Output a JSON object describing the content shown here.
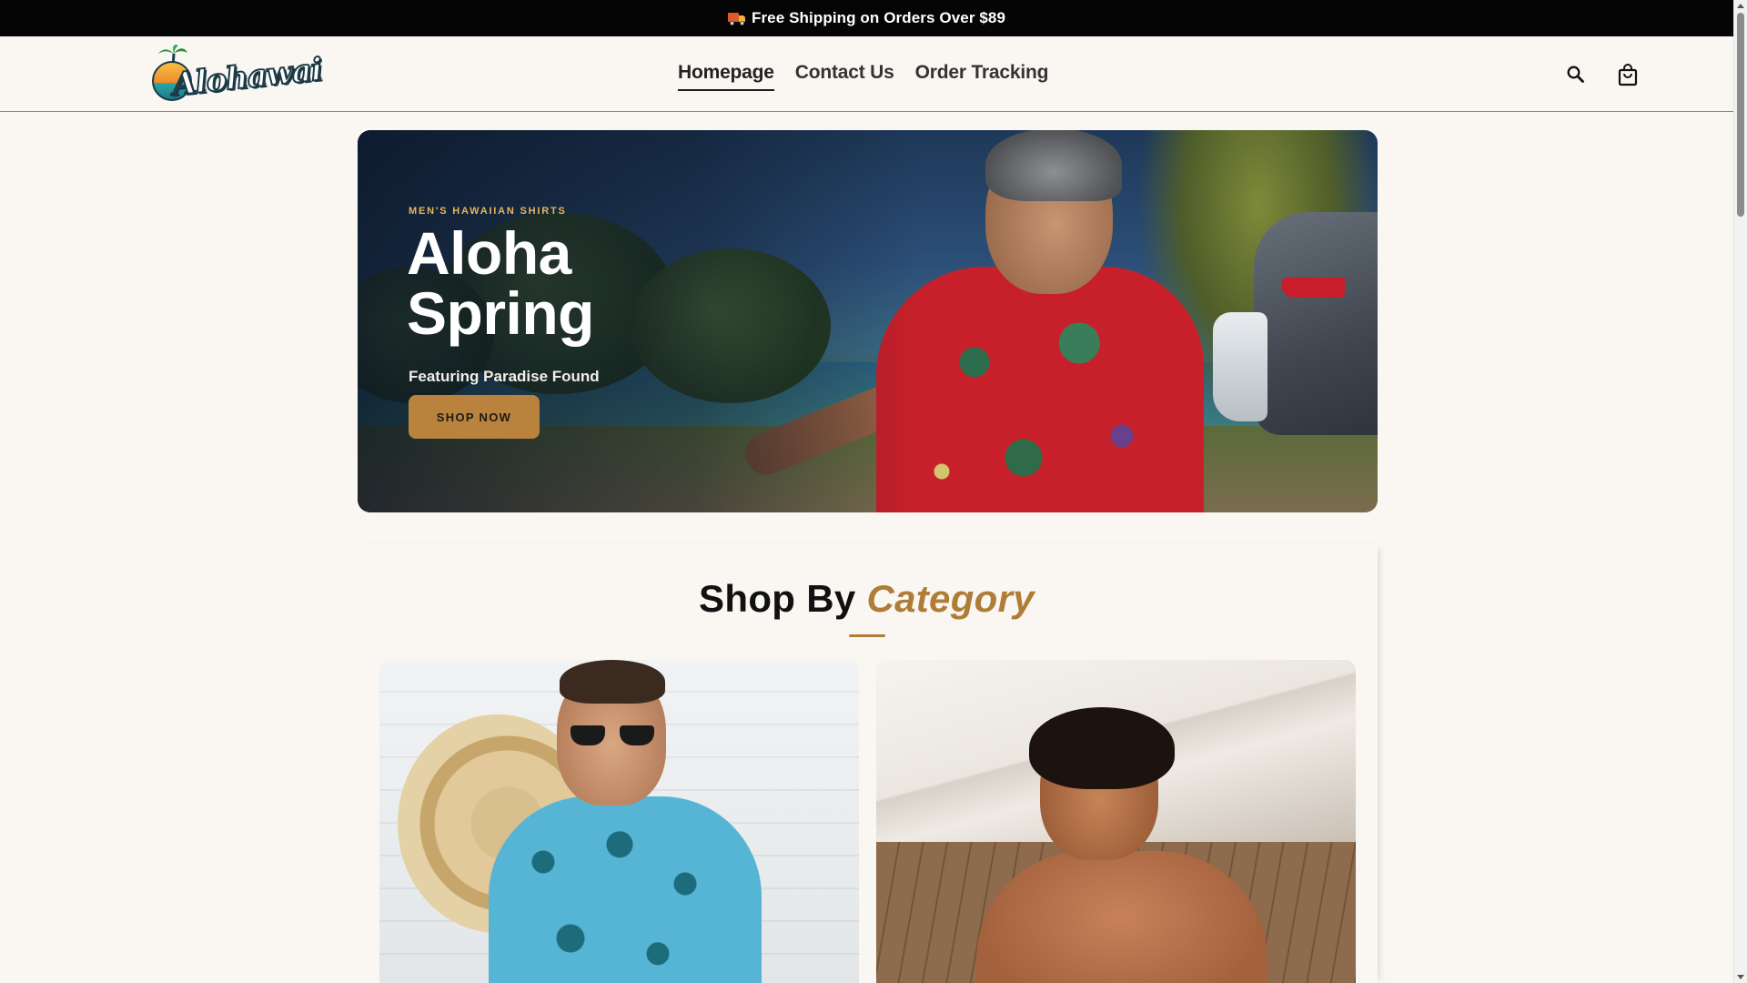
{
  "announcement": {
    "icon": "delivery-truck-icon",
    "text": "Free Shipping on Orders Over $89"
  },
  "header": {
    "logo_text": "Alohawai",
    "nav": [
      {
        "label": "Homepage",
        "active": true
      },
      {
        "label": "Contact Us",
        "active": false
      },
      {
        "label": "Order Tracking",
        "active": false
      }
    ],
    "icons": [
      "search-icon",
      "shopping-bag-icon"
    ]
  },
  "hero": {
    "eyebrow": "MEN'S HAWAIIAN SHIRTS",
    "title_line1": "Aloha",
    "title_line2": "Spring",
    "subtitle": "Featuring Paradise Found",
    "cta_label": "SHOP NOW",
    "image": "man-in-red-hawaiian-shirt-photo"
  },
  "category": {
    "heading_plain": "Shop By",
    "heading_accent": "Category",
    "cards": [
      {
        "image": "man-in-blue-palm-print-shirt-photo"
      },
      {
        "image": "shirtless-man-on-wooden-deck-photo"
      }
    ]
  },
  "colors": {
    "accent": "#b07d38",
    "button": "#b9833d",
    "eyebrow": "#e6b65c",
    "announce_bg": "#050505",
    "page_bg": "#faf7f2"
  }
}
